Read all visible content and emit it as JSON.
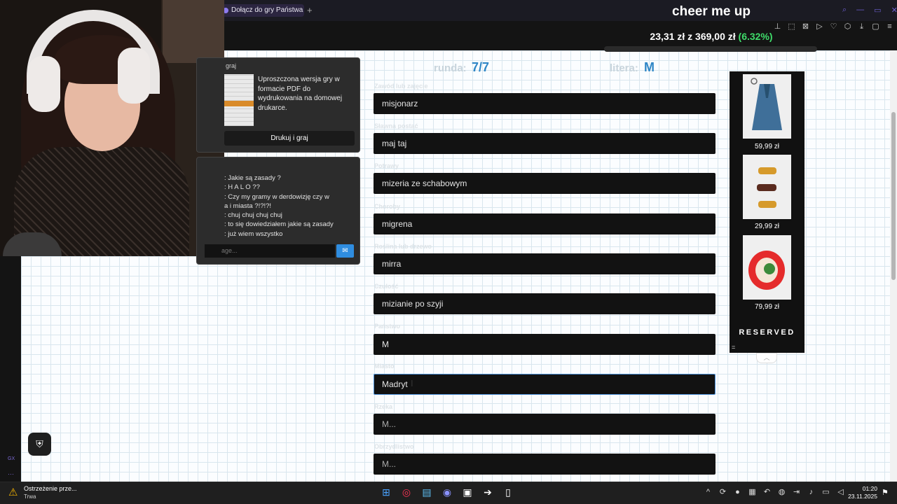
{
  "browser": {
    "tab_title": "Dołącz do gry Państwa M",
    "tab_add": "+",
    "toolbar_icons": [
      "pin-icon",
      "snapshot-icon",
      "flow-icon",
      "play-icon",
      "heart-icon",
      "extensions-icon",
      "download-icon",
      "sidebar-icon",
      "menu-icon"
    ],
    "window_controls": [
      "search-icon",
      "minimize-icon",
      "maximize-icon",
      "close-icon"
    ]
  },
  "overlay": {
    "title": "cheer me up",
    "raised": "23,31 zł",
    "separator": "z",
    "goal": "369,00 zł",
    "percent": "(6.32%)",
    "progress": 0.0632
  },
  "pdf_panel": {
    "heading": "graj",
    "description": "Uproszczona wersja gry w formacie PDF do wydrukowania na domowej drukarce.",
    "button": "Drukuj i graj"
  },
  "chat": {
    "messages": [
      ": Jakie są zasady ?",
      ": H A L O ??",
      ": Czy my gramy w derdowizję czy w",
      "a i miasta ?!?!?!",
      ": chuj chuj chuj chuj",
      ": to się dowiedziałem jakie są zasady",
      ": już wiem wszystko"
    ],
    "input_placeholder": "age...",
    "send_icon": "message-icon"
  },
  "game": {
    "round_label": "runda:",
    "round_value": "7/7",
    "letter_label": "litera:",
    "letter_value": "M",
    "categories": [
      {
        "label": "Zawód lub zajęcie",
        "value": "misjonarz"
      },
      {
        "label": "Sławna postać",
        "value": "maj taj"
      },
      {
        "label": "Potrawy",
        "value": "mizeria ze schabowym"
      },
      {
        "label": "Choroby",
        "value": "migrena"
      },
      {
        "label": "Roślina lub drzewo",
        "value": "mirra"
      },
      {
        "label": "Czułość",
        "value": "mizianie po szyji"
      },
      {
        "label": "Państwo",
        "value": "M"
      },
      {
        "label": "Miasto",
        "value": "Madryt"
      },
      {
        "label": "Rzeka",
        "placeholder": "M..."
      },
      {
        "label": "Obrzydlistwo",
        "placeholder": "M..."
      }
    ]
  },
  "shop": {
    "products": [
      {
        "name": "blue-coat-product",
        "price": "59,99 zł"
      },
      {
        "name": "dachshund-toys-product",
        "price": "29,99 zł"
      },
      {
        "name": "red-ornament-product",
        "price": "79,99 zł"
      }
    ],
    "brand": "RESERVED",
    "marker": "=",
    "toggle": "︿"
  },
  "taskbar": {
    "warning_title": "Ostrzeżenie prze...",
    "warning_subtitle": "Trwa",
    "apps": [
      "windows-start-icon",
      "opera-gx-icon",
      "notepad-icon",
      "discord-icon",
      "epic-games-icon",
      "arrow-app-icon",
      "file-icon"
    ],
    "time": "01:20",
    "date": "23.11.2025"
  },
  "sidebar_left": {
    "gx_label": "GX",
    "more": "···"
  },
  "colors": {
    "accent_blue": "#2f86c6",
    "donation_green": "#3fdc6a",
    "opera_purple": "#6c5fd0"
  }
}
